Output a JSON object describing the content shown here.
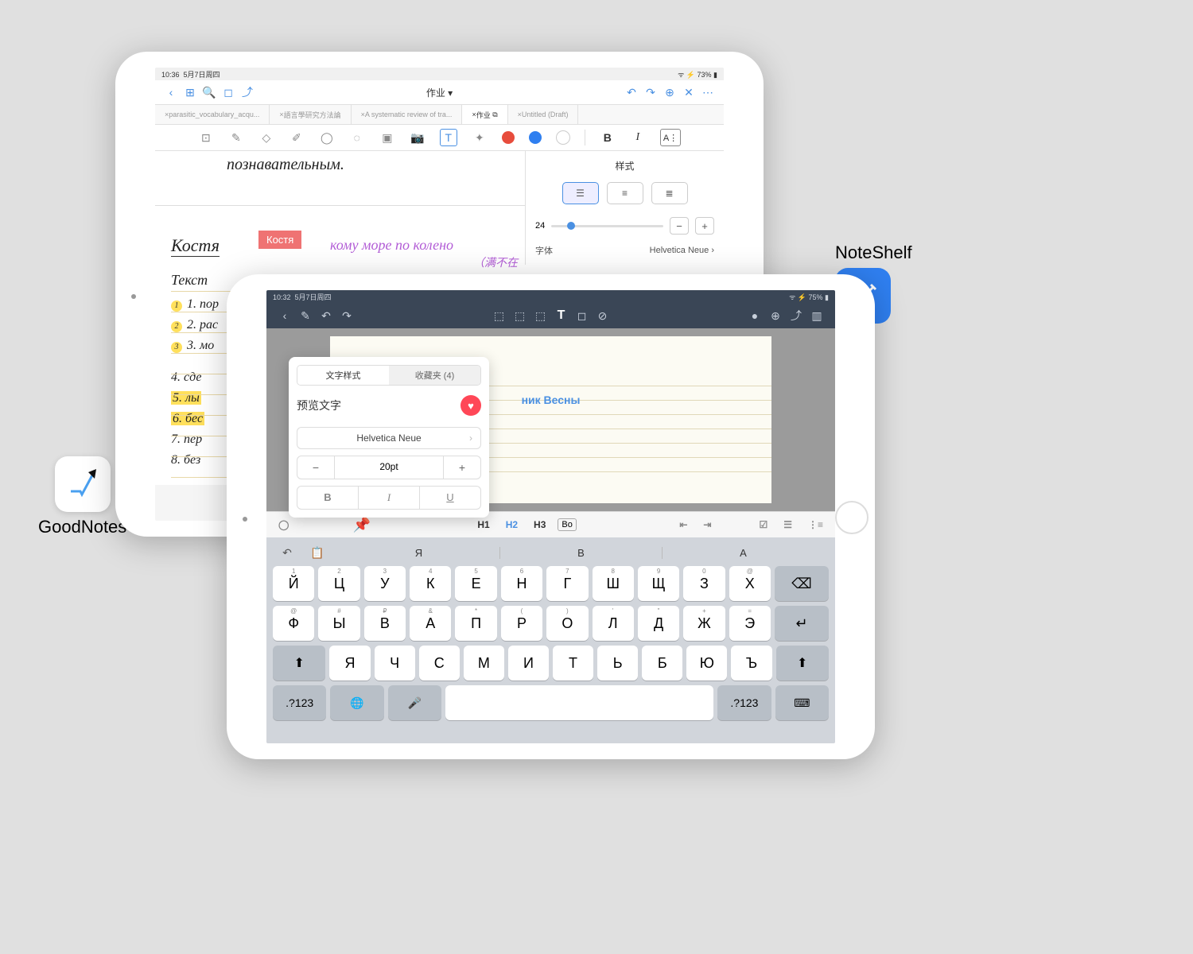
{
  "labels": {
    "goodnotes": "GoodNotes",
    "noteshelf": "NoteShelf"
  },
  "goodnotes": {
    "status": {
      "time": "10:36",
      "date": "5月7日周四",
      "battery": "73%"
    },
    "topbar_title": "作业",
    "tabs": [
      "parasitic_vocabulary_acqu...",
      "語言學研究方法論",
      "A systematic review of tra...",
      "作业",
      "Untitled (Draft)"
    ],
    "tab_active_index": 3,
    "toolbar_icons": [
      "view",
      "pen",
      "eraser",
      "highlighter",
      "shapes",
      "lasso",
      "image",
      "camera",
      "text",
      "link"
    ],
    "colors": [
      "#e74c3c",
      "#2f7ff0",
      "#ffffff"
    ],
    "handwriting_top": "познавательным.",
    "heading": "Костя",
    "typed_badge": "Костя",
    "purple_text": "кому море по колено",
    "purple_sub": "（满不在",
    "subtitle": "Текст",
    "bullets_yellow": [
      "1. пор",
      "2. рас",
      "3. мо"
    ],
    "bullets_plain": [
      "4. сде",
      "5. лы",
      "6. бес",
      "7. пер",
      "8. без"
    ],
    "style_panel": {
      "title": "样式",
      "font_size": "24",
      "font_label": "字体",
      "font_name": "Helvetica Neue"
    }
  },
  "noteshelf": {
    "status": {
      "time": "10:32",
      "date": "5月7日周四",
      "battery": "75%"
    },
    "paper_title": "ник Весны",
    "popover": {
      "tabs": [
        "文字样式",
        "收藏夹 (4)"
      ],
      "preview_label": "预览文字",
      "font": "Helvetica Neue",
      "size": "20pt",
      "biu": [
        "B",
        "I",
        "U"
      ]
    },
    "formatbar": {
      "h1": "H1",
      "h2": "H2",
      "h3": "H3",
      "body": "Во"
    },
    "keyboard": {
      "suggestions": [
        "Я",
        "В",
        "А"
      ],
      "row1_hints": [
        "1",
        "2",
        "3",
        "4",
        "5",
        "6",
        "7",
        "8",
        "9",
        "0",
        "@"
      ],
      "row1": [
        "Й",
        "Ц",
        "У",
        "К",
        "Е",
        "Н",
        "Г",
        "Ш",
        "Щ",
        "З",
        "Х"
      ],
      "row2_hints": [
        "@",
        "#",
        "₽",
        "&",
        "*",
        "(",
        ")",
        "'",
        "\"",
        "+",
        "="
      ],
      "row2": [
        "Ф",
        "Ы",
        "В",
        "А",
        "П",
        "Р",
        "О",
        "Л",
        "Д",
        "Ж",
        "Э"
      ],
      "row3": [
        "Я",
        "Ч",
        "С",
        "М",
        "И",
        "Т",
        "Ь",
        "Б",
        "Ю",
        "Ъ"
      ],
      "bottom": {
        "num": ".?123"
      }
    }
  }
}
